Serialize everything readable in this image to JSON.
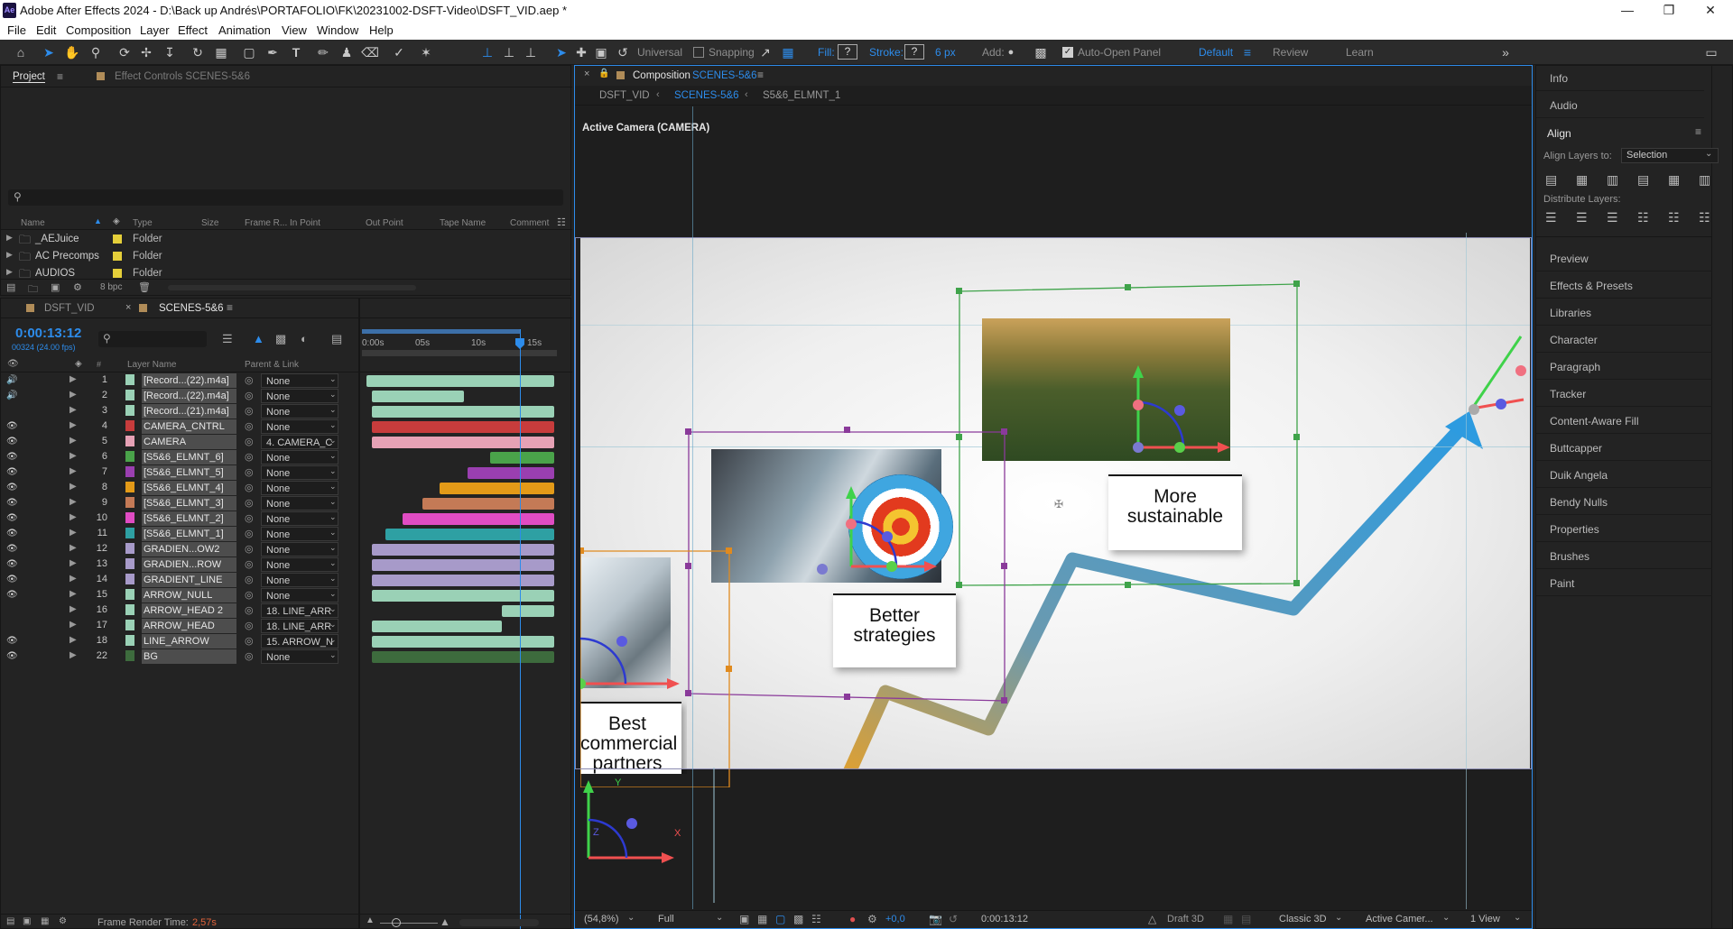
{
  "app": {
    "title": "Adobe After Effects 2024 - D:\\Back up Andrés\\PORTAFOLIO\\FK\\20231002-DSFT-Video\\DSFT_VID.aep *",
    "logo": "Ae"
  },
  "menu": [
    "File",
    "Edit",
    "Composition",
    "Layer",
    "Effect",
    "Animation",
    "View",
    "Window",
    "Help"
  ],
  "toolbar": {
    "universal": "Universal",
    "snapping": "Snapping",
    "fill_label": "Fill:",
    "fill_value": "?",
    "stroke_label": "Stroke:",
    "stroke_value": "?",
    "stroke_px": "6 px",
    "add_label": "Add:",
    "auto_open": "Auto-Open Panel",
    "workspace_default": "Default",
    "workspace_review": "Review",
    "workspace_learn": "Learn"
  },
  "project_panel": {
    "tab_project": "Project",
    "tab_effect_controls": "Effect Controls SCENES-5&6",
    "columns": [
      "Name",
      "Type",
      "Size",
      "Frame R...",
      "In Point",
      "Out Point",
      "Tape Name",
      "Comment"
    ],
    "items": [
      {
        "name": "_AEJuice",
        "type": "Folder"
      },
      {
        "name": "AC Precomps",
        "type": "Folder"
      },
      {
        "name": "AUDIOS",
        "type": "Folder"
      }
    ],
    "bpc": "8 bpc"
  },
  "timeline": {
    "tab1": "DSFT_VID",
    "tab2": "SCENES-5&6",
    "timecode": "0:00:13:12",
    "frame_info": "00324 (24.00 fps)",
    "col_layer_name": "Layer Name",
    "col_parent": "Parent & Link",
    "ruler": [
      "0:00s",
      "05s",
      "10s",
      "15s"
    ],
    "playhead_position": 0.81,
    "layers": [
      {
        "num": "1",
        "name": "[Record...(22).m4a]",
        "parent": "None",
        "color": "#9ad1b6",
        "start": 0.0,
        "end": 1.0,
        "eye": "audio"
      },
      {
        "num": "2",
        "name": "[Record...(22).m4a]",
        "parent": "None",
        "color": "#9ad1b6",
        "start": 0.03,
        "end": 0.52,
        "eye": "audio"
      },
      {
        "num": "3",
        "name": "[Record...(21).m4a]",
        "parent": "None",
        "color": "#9ad1b6",
        "start": 0.03,
        "end": 1.0,
        "eye": "none"
      },
      {
        "num": "4",
        "name": "CAMERA_CNTRL",
        "parent": "None",
        "color": "#c73c3c",
        "start": 0.03,
        "end": 1.0,
        "eye": "eye"
      },
      {
        "num": "5",
        "name": "CAMERA",
        "parent": "4. CAMERA_C",
        "color": "#e6a1b5",
        "start": 0.03,
        "end": 1.0,
        "eye": "eye"
      },
      {
        "num": "6",
        "name": "[S5&6_ELMNT_6]",
        "parent": "None",
        "color": "#4aa34a",
        "start": 0.66,
        "end": 1.0,
        "eye": "eye"
      },
      {
        "num": "7",
        "name": "[S5&6_ELMNT_5]",
        "parent": "None",
        "color": "#9a3fb0",
        "start": 0.54,
        "end": 1.0,
        "eye": "eye"
      },
      {
        "num": "8",
        "name": "[S5&6_ELMNT_4]",
        "parent": "None",
        "color": "#e39a18",
        "start": 0.39,
        "end": 1.0,
        "eye": "eye"
      },
      {
        "num": "9",
        "name": "[S5&6_ELMNT_3]",
        "parent": "None",
        "color": "#c47a56",
        "start": 0.3,
        "end": 1.0,
        "eye": "eye"
      },
      {
        "num": "10",
        "name": "[S5&6_ELMNT_2]",
        "parent": "None",
        "color": "#e04cc3",
        "start": 0.19,
        "end": 1.0,
        "eye": "eye"
      },
      {
        "num": "11",
        "name": "[S5&6_ELMNT_1]",
        "parent": "None",
        "color": "#2ea0a3",
        "start": 0.1,
        "end": 1.0,
        "eye": "eye"
      },
      {
        "num": "12",
        "name": "GRADIEN...OW2",
        "parent": "None",
        "color": "#a79ac9",
        "start": 0.03,
        "end": 1.0,
        "eye": "eye"
      },
      {
        "num": "13",
        "name": "GRADIEN...ROW",
        "parent": "None",
        "color": "#a79ac9",
        "start": 0.03,
        "end": 1.0,
        "eye": "eye"
      },
      {
        "num": "14",
        "name": "GRADIENT_LINE",
        "parent": "None",
        "color": "#a79ac9",
        "start": 0.03,
        "end": 1.0,
        "eye": "eye"
      },
      {
        "num": "15",
        "name": "ARROW_NULL",
        "parent": "None",
        "color": "#9ad1b6",
        "start": 0.03,
        "end": 1.0,
        "eye": "eye"
      },
      {
        "num": "16",
        "name": "ARROW_HEAD 2",
        "parent": "18. LINE_ARR",
        "color": "#9ad1b6",
        "start": 0.72,
        "end": 1.0,
        "eye": "none"
      },
      {
        "num": "17",
        "name": "ARROW_HEAD",
        "parent": "18. LINE_ARR",
        "color": "#9ad1b6",
        "start": 0.03,
        "end": 0.72,
        "eye": "none"
      },
      {
        "num": "18",
        "name": "LINE_ARROW",
        "parent": "15. ARROW_N",
        "color": "#9ad1b6",
        "start": 0.03,
        "end": 1.0,
        "eye": "eye"
      },
      {
        "num": "22",
        "name": "BG",
        "parent": "None",
        "color": "#3d6b3d",
        "start": 0.03,
        "end": 1.0,
        "eye": "eye"
      }
    ],
    "render_label": "Frame Render Time:",
    "render_value": "2,57s"
  },
  "composition": {
    "tab_label": "Composition",
    "tab_name": "SCENES-5&6",
    "breadcrumbs": [
      "DSFT_VID",
      "SCENES-5&6",
      "S5&6_ELMNT_1"
    ],
    "camera_label": "Active Camera (CAMERA)",
    "cards": {
      "card1": "More sustainable",
      "card2": "Better strategies",
      "card3": "Best commercial partners"
    },
    "axis_labels": {
      "y": "Y",
      "z": "Z",
      "x": "X"
    },
    "footer": {
      "zoom": "(54,8%)",
      "resolution": "Full",
      "exposure": "+0,0",
      "timecode": "0:00:13:12",
      "renderer": "Draft 3D",
      "mode": "Classic 3D",
      "camera": "Active Camer...",
      "views": "1 View"
    }
  },
  "right_panel": {
    "info": "Info",
    "audio": "Audio",
    "align": "Align",
    "align_layers_to": "Align Layers to:",
    "align_target": "Selection",
    "distribute": "Distribute Layers:",
    "items": [
      "Preview",
      "Effects & Presets",
      "Libraries",
      "Character",
      "Paragraph",
      "Tracker",
      "Content-Aware Fill",
      "Buttcapper",
      "Duik Angela",
      "Bendy Nulls",
      "Properties",
      "Brushes",
      "Paint"
    ]
  },
  "colors": {
    "accent": "#2d8ceb",
    "timecode": "#2d8ceb",
    "selection_purple": "#8a3a9a",
    "selection_green": "#3fa34a",
    "selection_orange": "#e08a1e"
  }
}
